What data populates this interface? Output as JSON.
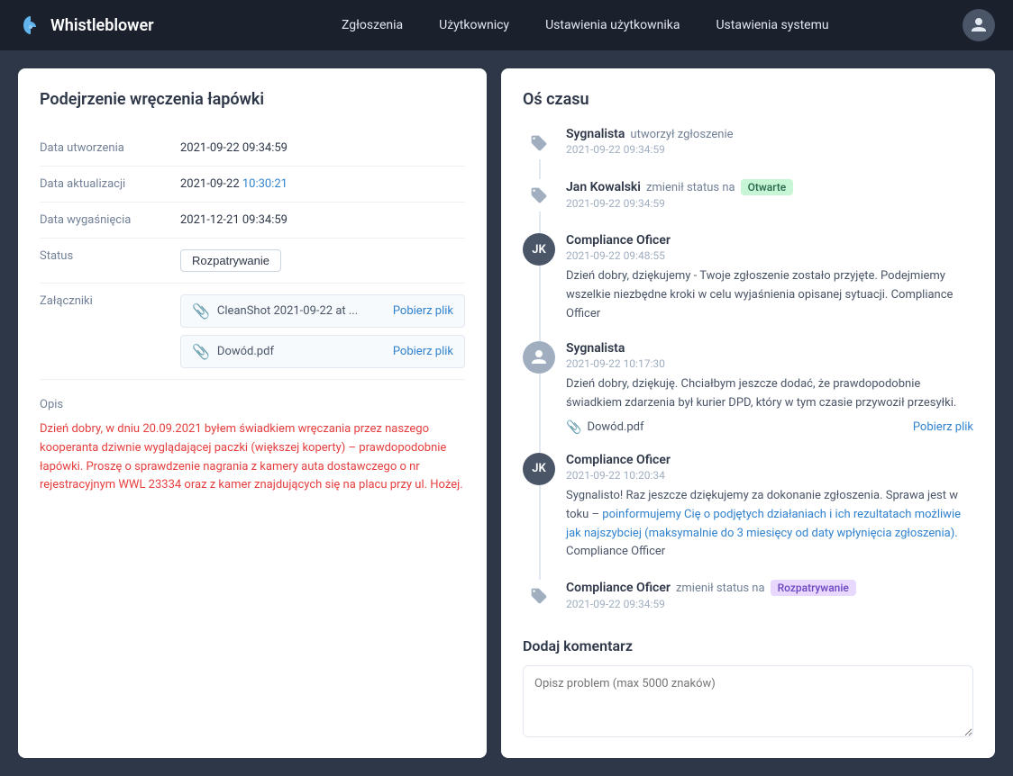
{
  "navbar": {
    "brand": "Whistleblower",
    "links": [
      {
        "label": "Zgłoszenia",
        "id": "submissions"
      },
      {
        "label": "Użytkownicy",
        "id": "users"
      },
      {
        "label": "Ustawienia użytkownika",
        "id": "user-settings"
      },
      {
        "label": "Ustawienia systemu",
        "id": "system-settings"
      }
    ]
  },
  "left_panel": {
    "title": "Podejrzenie wręczenia łapówki",
    "fields": {
      "created_label": "Data utworzenia",
      "created_value": "2021-09-22 09:34:59",
      "updated_label": "Data aktualizacji",
      "updated_value": "2021-09-22 ",
      "updated_highlight": "10:30:21",
      "expires_label": "Data wygaśnięcia",
      "expires_value": "2021-12-21 09:34:59",
      "status_label": "Status",
      "status_value": "Rozpatrywanie",
      "attachments_label": "Załączniki"
    },
    "attachments": [
      {
        "name": "CleanShot 2021-09-22 at ...",
        "action": "Pobierz plik"
      },
      {
        "name": "Dowód.pdf",
        "action": "Pobierz plik"
      }
    ],
    "description": {
      "label": "Opis",
      "text": "Dzień dobry, w dniu 20.09.2021 byłem świadkiem wręczania przez naszego kooperanta dziwnie wyglądającej paczki (większej koperty) – prawdopodobnie łapówki. Proszę o sprawdzenie nagrania z kamery auta dostawczego o nr rejestracyjnym WWL 23334 oraz z kamer znajdujących się na placu przy ul. Hożej."
    }
  },
  "right_panel": {
    "title": "Oś czasu",
    "timeline": [
      {
        "id": "event1",
        "avatar_type": "tag",
        "author": "Sygnalista",
        "action": "utworzył zgłoszenie",
        "date": "2021-09-22 09:34:59",
        "has_message": false
      },
      {
        "id": "event2",
        "avatar_type": "tag",
        "author": "Jan Kowalski",
        "action": "zmienił status na",
        "badge": "Otwarte",
        "badge_type": "green",
        "date": "2021-09-22 09:34:59",
        "has_message": false
      },
      {
        "id": "event3",
        "avatar_type": "dark",
        "avatar_initials": "JK",
        "author": "Compliance Oficer",
        "date": "2021-09-22 09:48:55",
        "has_message": true,
        "message": "Dzień dobry, dziękujemy - Twoje zgłoszenie zostało przyjęte. Podejmiemy wszelkie niezbędne kroki w celu wyjaśnienia opisanej sytuacji. Compliance Officer"
      },
      {
        "id": "event4",
        "avatar_type": "light",
        "avatar_initials": "",
        "author": "Sygnalista",
        "date": "2021-09-22 10:17:30",
        "has_message": true,
        "message": "Dzień dobry, dziękuję. Chciałbym jeszcze dodać, że prawdopodobnie świadkiem zdarzenia był kurier DPD, który w tym czasie przywoził przesyłki.",
        "attachment": {
          "name": "Dowód.pdf",
          "action": "Pobierz plik"
        }
      },
      {
        "id": "event5",
        "avatar_type": "dark",
        "avatar_initials": "JK",
        "author": "Compliance Oficer",
        "date": "2021-09-22 10:20:34",
        "has_message": true,
        "message_parts": [
          {
            "text": "Sygnalisto! Raz jeszcze dziękujemy za dokonanie zgłoszenia. Sprawa jest w toku – "
          },
          {
            "text": "poinformujemy Cię o podjętych działaniach i ich rezultatach możliwie jak najszybciej (maksymalnie do 3 miesięcy od daty wpłynięcia zgłoszenia).",
            "highlight": true
          },
          {
            "text": " Compliance Officer"
          }
        ]
      },
      {
        "id": "event6",
        "avatar_type": "tag",
        "author": "Compliance Oficer",
        "action": "zmienił status na",
        "badge": "Rozpatrywanie",
        "badge_type": "purple",
        "date": "2021-09-22 09:34:59",
        "has_message": false
      }
    ],
    "comment": {
      "title": "Dodaj komentarz",
      "placeholder": "Opisz problem (max 5000 znaków)"
    }
  }
}
